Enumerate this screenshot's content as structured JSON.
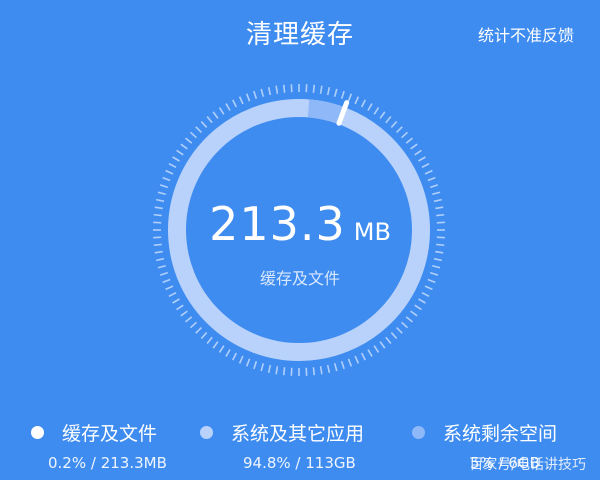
{
  "header": {
    "title": "清理缓存",
    "feedback_label": "统计不准反馈"
  },
  "gauge": {
    "value": "213.3",
    "unit": "MB",
    "caption": "缓存及文件",
    "progress_fraction": 0.057,
    "colors": {
      "ring_base": "#b9d2fb",
      "ring_used": "#8eb8f8",
      "ticks": "#d6e6ff",
      "marker": "#ffffff"
    }
  },
  "legend": [
    {
      "label": "缓存及文件",
      "stat": "0.2% / 213.3MB",
      "dot_color": "#ffffff"
    },
    {
      "label": "系统及其它应用",
      "stat": "94.8% / 113GB",
      "dot_color": "#b9d2fb"
    },
    {
      "label": "系统剩余空间",
      "stat": "5% / 6GB",
      "dot_color": "#8eb8f8"
    }
  ],
  "watermark": "百家号/电话讲技巧"
}
